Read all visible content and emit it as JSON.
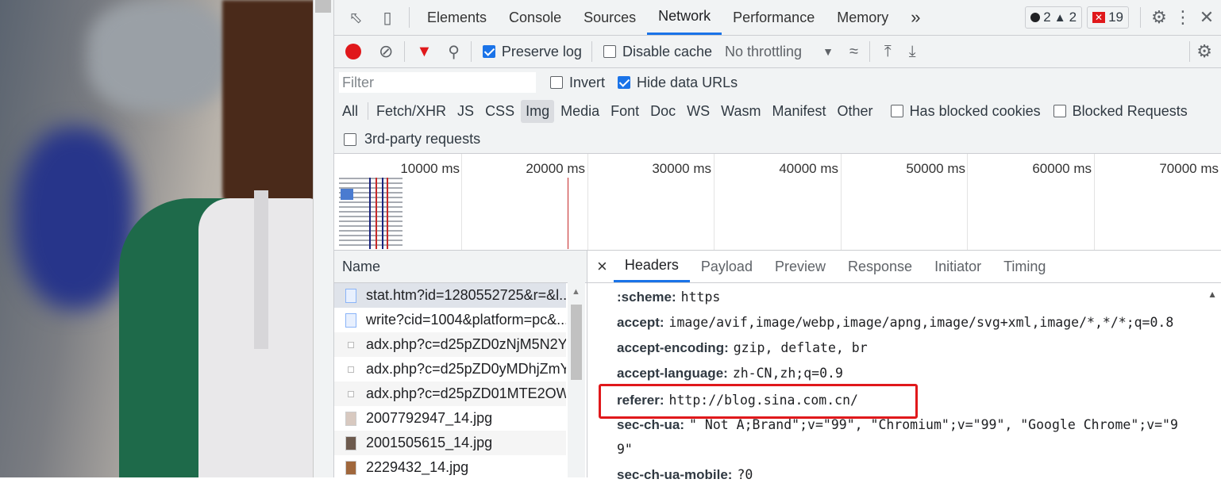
{
  "devtools": {
    "tabs": [
      "Elements",
      "Console",
      "Sources",
      "Network",
      "Performance",
      "Memory"
    ],
    "active_tab": "Network",
    "more_tabs": "»",
    "errors": "2",
    "warnings": "2",
    "issues": "19"
  },
  "toolbar": {
    "preserve_log": "Preserve log",
    "disable_cache": "Disable cache",
    "throttling": "No throttling"
  },
  "filter": {
    "placeholder": "Filter",
    "invert": "Invert",
    "hide_data_urls": "Hide data URLs",
    "types": [
      "All",
      "Fetch/XHR",
      "JS",
      "CSS",
      "Img",
      "Media",
      "Font",
      "Doc",
      "WS",
      "Wasm",
      "Manifest",
      "Other"
    ],
    "active_type": "Img",
    "has_blocked_cookies": "Has blocked cookies",
    "blocked_requests": "Blocked Requests",
    "third_party": "3rd-party requests"
  },
  "overview": {
    "ticks": [
      "10000 ms",
      "20000 ms",
      "30000 ms",
      "40000 ms",
      "50000 ms",
      "60000 ms",
      "70000 ms"
    ]
  },
  "requests": {
    "header": "Name",
    "items": [
      "stat.htm?id=1280552725&r=&l...",
      "write?cid=1004&platform=pc&...",
      "adx.php?c=d25pZD0zNjM5N2Y...",
      "adx.php?c=d25pZD0yMDhjZmY...",
      "adx.php?c=d25pZD01MTE2OW...",
      "2007792947_14.jpg",
      "2001505615_14.jpg",
      "2229432_14.jpg"
    ]
  },
  "details": {
    "close": "×",
    "tabs": [
      "Headers",
      "Payload",
      "Preview",
      "Response",
      "Initiator",
      "Timing"
    ],
    "active_tab": "Headers",
    "headers": [
      {
        "k": ":scheme:",
        "v": "https"
      },
      {
        "k": "accept:",
        "v": "image/avif,image/webp,image/apng,image/svg+xml,image/*,*/*;q=0.8"
      },
      {
        "k": "accept-encoding:",
        "v": "gzip, deflate, br"
      },
      {
        "k": "accept-language:",
        "v": "zh-CN,zh;q=0.9"
      },
      {
        "k": "referer:",
        "v": "http://blog.sina.com.cn/"
      },
      {
        "k": "sec-ch-ua:",
        "v": "\" Not A;Brand\";v=\"99\", \"Chromium\";v=\"99\", \"Google Chrome\";v=\"9"
      },
      {
        "k": "",
        "v": "9\""
      },
      {
        "k": "sec-ch-ua-mobile:",
        "v": "?0"
      }
    ]
  }
}
